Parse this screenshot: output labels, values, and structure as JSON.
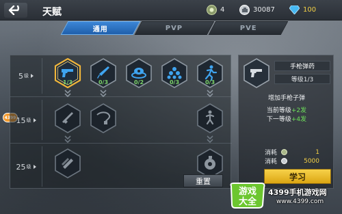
{
  "header": {
    "title": "天赋",
    "resources": {
      "medal": "4",
      "coins": "30087",
      "diamonds": "100"
    }
  },
  "tabs": [
    {
      "label": "通用",
      "active": true
    },
    {
      "label": "PVP",
      "active": false
    },
    {
      "label": "PVE",
      "active": false
    }
  ],
  "tiers": [
    {
      "level": "5",
      "unit": "级"
    },
    {
      "level": "15",
      "unit": "级"
    },
    {
      "level": "25",
      "unit": "级"
    }
  ],
  "skills_tier1": [
    {
      "icon": "pistol-icon",
      "progress": "1/3",
      "selected": true
    },
    {
      "icon": "knife-icon",
      "progress": "0/3"
    },
    {
      "icon": "grenade-pile-icon",
      "progress": "0/2"
    },
    {
      "icon": "ammo-pile-icon",
      "progress": "0/3"
    },
    {
      "icon": "sprint-icon",
      "progress": "0/3"
    }
  ],
  "skills_tier2": [
    {
      "icon": "rifle-icon"
    },
    {
      "icon": "whip-icon"
    },
    {
      "icon": "runner-icon"
    }
  ],
  "skills_tier3": [
    {
      "icon": "weapon-case-icon"
    },
    {
      "icon": "frag-grenade-icon"
    }
  ],
  "reset_label": "重置",
  "side_badge": "4399",
  "detail": {
    "icon": "pistol-icon",
    "name": "手枪弹药",
    "level": "等级1/3",
    "description": "增加手枪子弹",
    "current_prefix": "当前等级",
    "current_value": "+2发",
    "next_prefix": "下一等级",
    "next_value": "+4发",
    "cost_rows": [
      {
        "label": "消耗",
        "value": "1"
      },
      {
        "label": "消耗",
        "value": "5000"
      }
    ],
    "learn_label": "学习"
  },
  "watermark": {
    "logo_line1": "游戏",
    "logo_line2": "大全",
    "site_name": "4399手机游戏网",
    "site_url": "www.4399.com"
  },
  "colors": {
    "accent_blue": "#2b74c6",
    "level_green": "#7dd36a",
    "gold": "#f3d046",
    "learn_button": "#f2c22f"
  }
}
